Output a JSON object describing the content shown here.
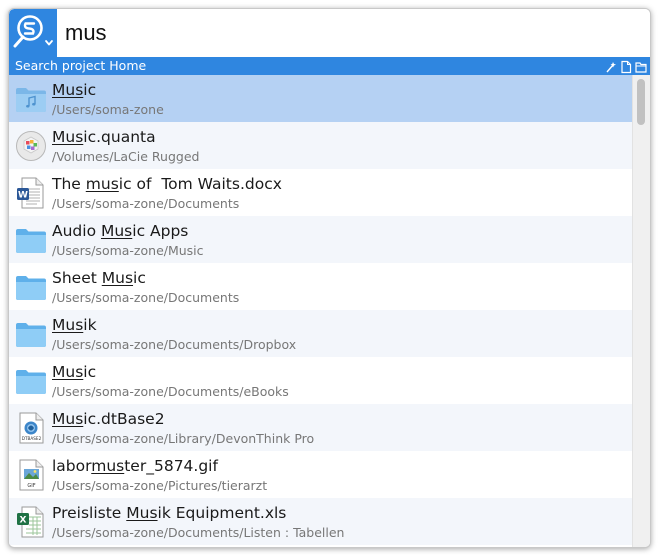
{
  "search": {
    "query": "mus"
  },
  "scope": {
    "label": "Search project Home"
  },
  "colors": {
    "accent": "#2f86e0",
    "selected_row": "#b5d1f3",
    "alt_row": "#f3f6fb"
  },
  "results": [
    {
      "pre": "",
      "match": "Mus",
      "post": "ic",
      "path": "/Users/soma-zone",
      "icon": "music-folder-icon"
    },
    {
      "pre": "",
      "match": "Mus",
      "post": "ic.quanta",
      "path": "/Volumes/LaCie Rugged",
      "icon": "quanta-app-icon"
    },
    {
      "pre": "The ",
      "match": "mus",
      "post": "ic of  Tom Waits.docx",
      "path": "/Users/soma-zone/Documents",
      "icon": "word-document-icon"
    },
    {
      "pre": "Audio ",
      "match": "Mus",
      "post": "ic Apps",
      "path": "/Users/soma-zone/Music",
      "icon": "folder-icon"
    },
    {
      "pre": "Sheet ",
      "match": "Mus",
      "post": "ic",
      "path": "/Users/soma-zone/Documents",
      "icon": "folder-icon"
    },
    {
      "pre": "",
      "match": "Mus",
      "post": "ik",
      "path": "/Users/soma-zone/Documents/Dropbox",
      "icon": "folder-icon"
    },
    {
      "pre": "",
      "match": "Mus",
      "post": "ic",
      "path": "/Users/soma-zone/Documents/eBooks",
      "icon": "folder-icon"
    },
    {
      "pre": "",
      "match": "Mus",
      "post": "ic.dtBase2",
      "path": "/Users/soma-zone/Library/DevonThink Pro",
      "icon": "dtbase-document-icon"
    },
    {
      "pre": "labor",
      "match": "mus",
      "post": "ter_5874.gif",
      "path": "/Users/soma-zone/Pictures/tierarzt",
      "icon": "gif-document-icon"
    },
    {
      "pre": "Preisliste ",
      "match": "Mus",
      "post": "ik Equipment.xls",
      "path": "/Users/soma-zone/Documents/Listen : Tabellen",
      "icon": "excel-document-icon"
    }
  ]
}
